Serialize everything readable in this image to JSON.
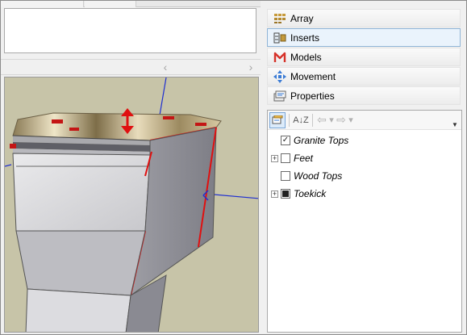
{
  "right_panel": {
    "menu": [
      {
        "label": "Array",
        "icon": "array-icon",
        "selected": false
      },
      {
        "label": "Inserts",
        "icon": "inserts-icon",
        "selected": true
      },
      {
        "label": "Models",
        "icon": "models-icon",
        "selected": false
      },
      {
        "label": "Movement",
        "icon": "movement-icon",
        "selected": false
      },
      {
        "label": "Properties",
        "icon": "properties-icon",
        "selected": false
      }
    ],
    "toolbar": {
      "sort_label": "A↓Z",
      "back_glyph": "⇦",
      "forward_glyph": "⇨",
      "dropdown_glyph": "▾"
    },
    "tree": [
      {
        "label": "Granite Tops",
        "state": "checked",
        "expandable": false
      },
      {
        "label": "Feet",
        "state": "unchecked",
        "expandable": true
      },
      {
        "label": "Wood Tops",
        "state": "unchecked",
        "expandable": false
      },
      {
        "label": "Toekick",
        "state": "indeterminate",
        "expandable": true
      }
    ]
  },
  "left_panel": {
    "scroll_left_glyph": "‹",
    "scroll_right_glyph": "›"
  },
  "colors": {
    "selected_bg": "#eaf3fc",
    "selected_border": "#8fb4d6",
    "viewport_bg": "#c7c4a8",
    "axis_blue": "#1f2fd1",
    "highlight_red": "#e01010"
  }
}
